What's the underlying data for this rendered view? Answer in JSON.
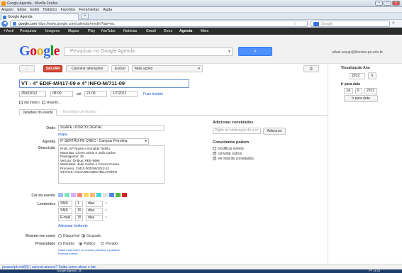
{
  "window": {
    "title": "Google Agenda - Mozilla Firefox"
  },
  "menu": [
    "Arquivo",
    "Editar",
    "Exibir",
    "Histórico",
    "Favoritos",
    "Ferramentas",
    "Ajuda"
  ],
  "tab": {
    "label": "Google Agenda"
  },
  "nav": {
    "url_domain": "google.com",
    "url_rest": "https://www.google.com/calendar/render?tab=mc",
    "search_placeholder": "Google"
  },
  "gbar": [
    "+Você",
    "Pesquisar",
    "Imagens",
    "Mapas",
    "Play",
    "YouTube",
    "Notícias",
    "Gmail",
    "Docs",
    "Agenda",
    "Mais"
  ],
  "gbar_active": "Agenda",
  "header": {
    "search_placeholder": "Pesquisar no Google Agenda",
    "user": "rafael.araujo@ifsertao-pe.edu.br"
  },
  "toolbar": {
    "back": "←",
    "save": "SALVAR",
    "cancel": "Cancelar alterações",
    "delete": "Excluir",
    "more": "Mais ações",
    "print": "⎙"
  },
  "event": {
    "title": "VT - 4° EDIF-M/417-09 e 4° INFO-M/711-09",
    "start_date": "25/6/2012",
    "start_time": "08:00",
    "until": "até",
    "end_time": "21:00",
    "end_date": "1/7/2012",
    "timezone": "Fuso horário",
    "allday": "dia inteiro",
    "repeat": "Repetir..."
  },
  "tabs": [
    "Detalhes do evento",
    "Encontrar um horário"
  ],
  "details": {
    "where_label": "Onde",
    "where": "SUAPE / PORTO DIGITAL",
    "map": "mapa",
    "calendar_label": "Agenda",
    "calendar": "IF SERTÃO-PE CREC - Campus Petrolina",
    "description_label": "Descrição",
    "description": [
      "Profs. Mª Nizete e Ronaldo Teófilo.",
      "Motorista: Cícero Jesus e João Carlos",
      "Passageiros: 36",
      "Veículo: Ônibus, PEE-9996",
      "Motoristas: João Carlos e Cícero Pereira",
      "Processo: 23415.000206/2012-13",
      "STATUS: AGUARDANDO RELATÓRIO"
    ],
    "color_label": "Cor do evento",
    "colors": [
      "#a4bdfc",
      "#7ae7bf",
      "#dbadff",
      "#ff887c",
      "#fbd75b",
      "#ffb878",
      "#46d6db",
      "#e1e1e1",
      "#5484ed",
      "#51b749",
      "#dc2127"
    ],
    "reminders_label": "Lembretes",
    "reminders": [
      {
        "type": "SMS",
        "value": "1",
        "unit": "dias"
      },
      {
        "type": "SMS",
        "value": "15",
        "unit": "dias"
      },
      {
        "type": "E-mail",
        "value": "15",
        "unit": "dias"
      }
    ],
    "add_reminder": "Adicionar lembrete",
    "show_as_label": "Mostrar-me como",
    "available": "Disponível",
    "busy": "Ocupado",
    "privacy_label": "Privacidade",
    "default": "Padrão",
    "public": "Público",
    "private": "Privado",
    "privacy_help": "Saiba mais sobre os eventos privados e públicos.",
    "publish": "Publicar evento"
  },
  "guests": {
    "title": "Adicionar convidados",
    "placeholder": "Digite os endereços de e-m",
    "add": "Adicionar",
    "can_title": "Convidados podem",
    "modify": "modificar evento",
    "invite": "convidar outros",
    "see": "ver lista de convidados"
  },
  "sidebar": {
    "view_label": "Visualização Ano",
    "year": "2012",
    "go": "Ir",
    "goto_label": "Ir para data",
    "month": "Jul",
    "day": "6",
    "yr": "2012",
    "goto_btn": "Ir para data"
  },
  "status": {
    "text": "javascript:void(0) | ucional anexos? Saiba como ativar o lab."
  },
  "taskbar": {
    "window": "Google Agenda - M...",
    "clock": "PT  14:10"
  }
}
